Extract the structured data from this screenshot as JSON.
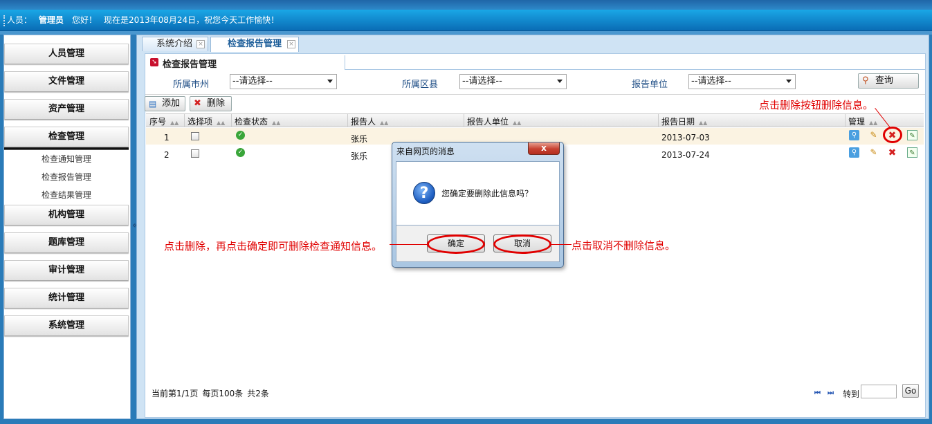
{
  "header": {
    "user_label": "人员：",
    "user_name": "管理员",
    "greeting": "您好！",
    "date_text": "现在是2013年08月24日，祝您今天工作愉快！"
  },
  "sidebar": {
    "items": [
      {
        "label": "人员管理"
      },
      {
        "label": "文件管理"
      },
      {
        "label": "资产管理"
      },
      {
        "label": "检查管理"
      },
      {
        "label": "机构管理"
      },
      {
        "label": "题库管理"
      },
      {
        "label": "审计管理"
      },
      {
        "label": "统计管理"
      },
      {
        "label": "系统管理"
      }
    ],
    "subitems": [
      {
        "label": "检查通知管理"
      },
      {
        "label": "检查报告管理"
      },
      {
        "label": "检查结果管理"
      }
    ],
    "collapse_glyph": "«"
  },
  "tabs": [
    {
      "label": "系统介绍",
      "close": "×"
    },
    {
      "label": "检查报告管理",
      "close": "×"
    }
  ],
  "panel": {
    "title": "检查报告管理",
    "filters": [
      {
        "label": "所属市州",
        "value": "--请选择--"
      },
      {
        "label": "所属区县",
        "value": "--请选择--"
      },
      {
        "label": "报告单位",
        "value": "--请选择--"
      }
    ],
    "query_label": "查询",
    "add_label": "添加",
    "delete_label": "删除"
  },
  "table": {
    "columns": [
      "序号",
      "选择项",
      "检查状态",
      "报告人",
      "报告人单位",
      "报告日期",
      "管理"
    ],
    "rows": [
      {
        "no": "1",
        "reporter": "张乐",
        "unit": "",
        "date": "2013-07-03",
        "status": "ok"
      },
      {
        "no": "2",
        "reporter": "张乐",
        "unit": "",
        "date": "2013-07-24",
        "status": "ok"
      }
    ]
  },
  "pager": {
    "current": "当前第1/1页",
    "per_page": "每页100条",
    "total": "共2条",
    "first": "⏮",
    "next": "⏭",
    "goto_label": "转到",
    "go": "Go"
  },
  "dialog": {
    "title": "来自网页的消息",
    "close": "x",
    "message": "您确定要删除此信息吗？",
    "ok_label": "确定",
    "cancel_label": "取消",
    "icon_glyph": "?"
  },
  "annotations": {
    "delete_hint": "点击删除按钮删除信息。",
    "confirm_hint": "点击删除，再点击确定即可删除检查通知信息。",
    "cancel_hint": "点击取消不删除信息。",
    "color": "#e00000"
  }
}
